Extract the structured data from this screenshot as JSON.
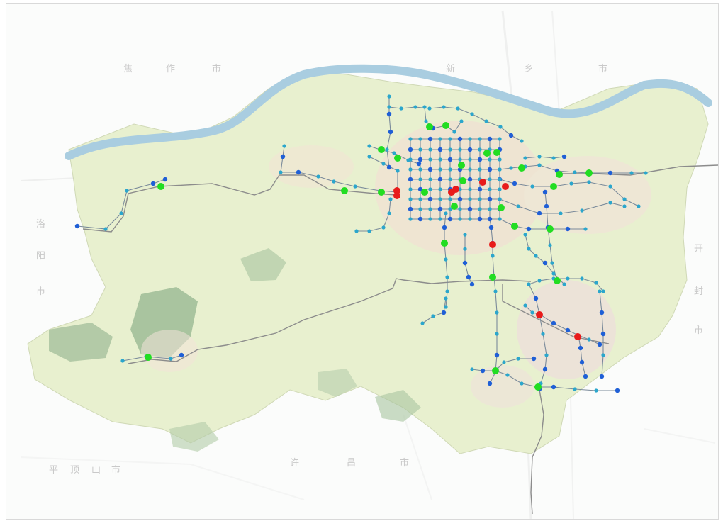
{
  "map": {
    "colors": {
      "background": "#fbfcfb",
      "region_fill": "#e8f0cf",
      "river": "#a9cde0",
      "forest": "#7fa57a",
      "transit_line": "#7a8a9a",
      "rail_line": "#8c8c8c",
      "station_regular": "#2ba6cc",
      "station_main": "#1f5fd6",
      "hub_green": "#22dd22",
      "hub_red": "#e81b1b"
    },
    "faint_labels": [
      {
        "id": "label-north-1",
        "text": "焦"
      },
      {
        "id": "label-north-2",
        "text": "作"
      },
      {
        "id": "label-north-3",
        "text": "市"
      },
      {
        "id": "label-north-4",
        "text": "新"
      },
      {
        "id": "label-north-5",
        "text": "乡"
      },
      {
        "id": "label-north-6",
        "text": "市"
      },
      {
        "id": "label-west-1",
        "text": "洛"
      },
      {
        "id": "label-west-2",
        "text": "阳"
      },
      {
        "id": "label-west-3",
        "text": "市"
      },
      {
        "id": "label-east-1",
        "text": "开"
      },
      {
        "id": "label-east-2",
        "text": "封"
      },
      {
        "id": "label-east-3",
        "text": "市"
      },
      {
        "id": "label-south-1",
        "text": "平"
      },
      {
        "id": "label-south-2",
        "text": "顶"
      },
      {
        "id": "label-south-3",
        "text": "山"
      },
      {
        "id": "label-south-4",
        "text": "市"
      },
      {
        "id": "label-south-5",
        "text": "许"
      },
      {
        "id": "label-south-6",
        "text": "昌"
      },
      {
        "id": "label-south-7",
        "text": "市"
      }
    ]
  }
}
